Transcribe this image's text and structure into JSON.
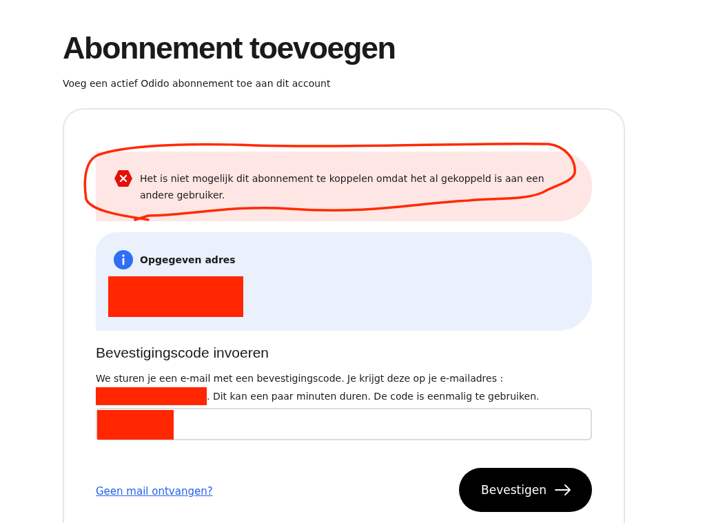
{
  "page": {
    "title": "Abonnement toevoegen",
    "subtitle": "Voeg een actief Odido abonnement toe aan dit account"
  },
  "alerts": [
    {
      "kind": "error",
      "text": "Het is niet mogelijk dit abonnement te koppelen omdat het al gekoppeld is aan een andere gebruiker.",
      "annotated": true
    },
    {
      "kind": "info",
      "title": "Opgegeven adres",
      "redacted": true
    }
  ],
  "verification": {
    "heading": "Bevestigingscode invoeren",
    "text_before": "We sturen je een e-mail met een bevestigingscode. Je krijgt deze op je e-mailadres :",
    "email_redacted": true,
    "text_after": ". Dit kan een paar minuten duren. De code is eenmalig te gebruiken.",
    "code_redacted": true
  },
  "footer": {
    "link": "Geen mail ontvangen?",
    "button": "Bevestigen"
  }
}
